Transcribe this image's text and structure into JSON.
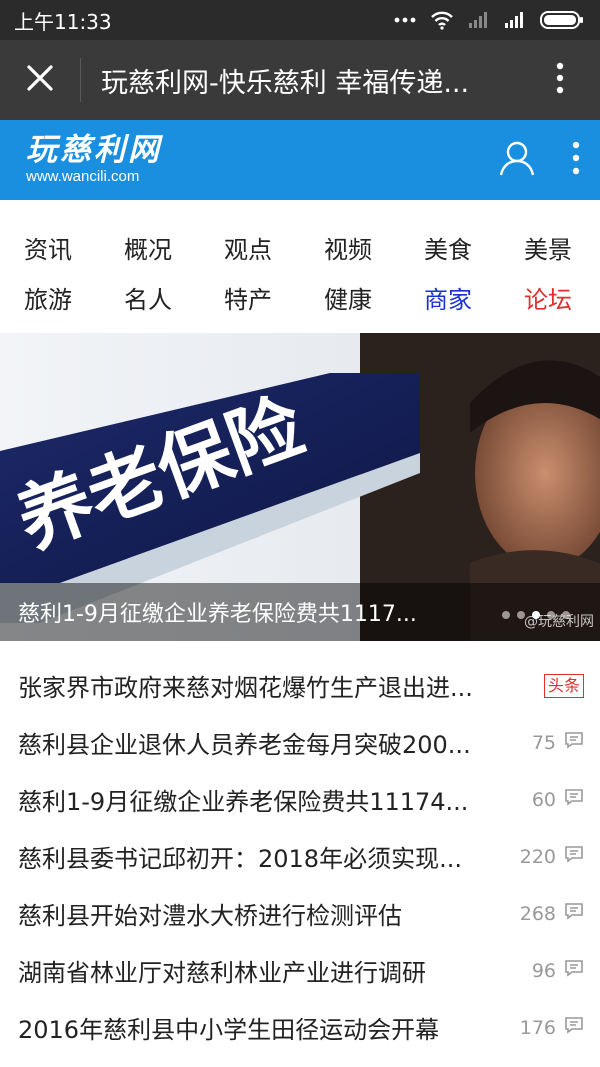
{
  "status_bar": {
    "time": "上午11:33"
  },
  "title_bar": {
    "title": "玩慈利网-快乐慈利 幸福传递..."
  },
  "site": {
    "logo_cn": "玩慈利网",
    "logo_url": "www.wancili.com",
    "colors": {
      "header_bg": "#1a8fe0"
    }
  },
  "categories": [
    {
      "label": "资讯",
      "color": "#222222"
    },
    {
      "label": "概况",
      "color": "#222222"
    },
    {
      "label": "观点",
      "color": "#222222"
    },
    {
      "label": "视频",
      "color": "#222222"
    },
    {
      "label": "美食",
      "color": "#222222"
    },
    {
      "label": "美景",
      "color": "#222222"
    },
    {
      "label": "旅游",
      "color": "#222222"
    },
    {
      "label": "名人",
      "color": "#222222"
    },
    {
      "label": "特产",
      "color": "#222222"
    },
    {
      "label": "健康",
      "color": "#222222"
    },
    {
      "label": "商家",
      "color": "#1a2fd6"
    },
    {
      "label": "论坛",
      "color": "#e52e2e"
    }
  ],
  "banner": {
    "image_text": "养老保险",
    "caption": "慈利1-9月征缴企业养老保险费共1117...",
    "watermark": "@玩慈利网",
    "slide_count": 5,
    "active_slide": 2
  },
  "news": [
    {
      "title": "张家界市政府来慈对烟花爆竹生产退出进...",
      "badge": "头条",
      "comments": null
    },
    {
      "title": "慈利县企业退休人员养老金每月突破200...",
      "badge": null,
      "comments": "75"
    },
    {
      "title": "慈利1-9月征缴企业养老保险费共11174...",
      "badge": null,
      "comments": "60"
    },
    {
      "title": "慈利县委书记邱初开：2018年必须实现...",
      "badge": null,
      "comments": "220"
    },
    {
      "title": "慈利县开始对澧水大桥进行检测评估",
      "badge": null,
      "comments": "268"
    },
    {
      "title": "湖南省林业厅对慈利林业产业进行调研",
      "badge": null,
      "comments": "96"
    },
    {
      "title": "2016年慈利县中小学生田径运动会开幕",
      "badge": null,
      "comments": "176"
    }
  ]
}
